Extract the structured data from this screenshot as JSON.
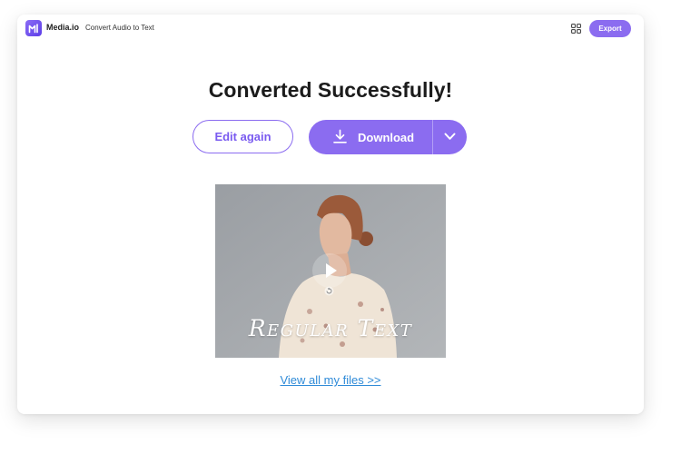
{
  "header": {
    "brand": "Media.io",
    "tool_title": "Convert Audio to Text",
    "apps_icon": "grid-apps-icon",
    "export_label": "Export"
  },
  "main": {
    "headline": "Converted Successfully!",
    "edit_label": "Edit again",
    "download_label": "Download",
    "download_icon": "download-icon",
    "dropdown_icon": "chevron-down-icon",
    "preview": {
      "overlay_text": "Regular Text",
      "play_icon": "play-icon",
      "replay_icon": "replay-icon"
    },
    "view_files_link": "View all my files >>"
  },
  "colors": {
    "accent": "#8b6cf0",
    "link": "#2f8bd8",
    "headline": "#1b1b1b"
  }
}
